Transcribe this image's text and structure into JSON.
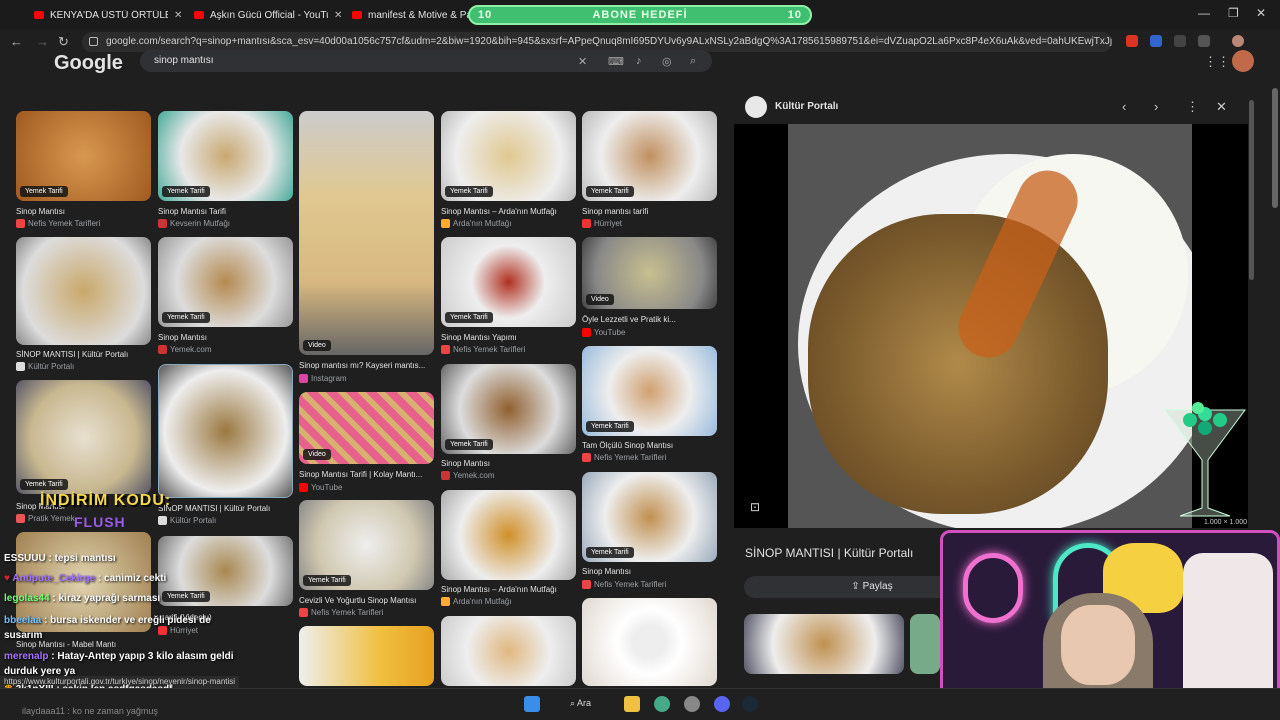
{
  "tabs": [
    {
      "title": "KENYA'DA ÜSTÜ ÖRTÜLEN KO..."
    },
    {
      "title": "Aşkın Gücü Official - YouTube"
    },
    {
      "title": "manifest & Motive & Pango"
    }
  ],
  "goal": {
    "left": "10",
    "label": "ABONE HEDEFİ",
    "right": "10"
  },
  "url": "google.com/search?q=sinop+mantısı&sca_esv=40d00a1056c757cf&udm=2&biw=1920&bih=945&sxsrf=APpeQnuq8mI695DYUv6y9ALxNSLy2aBdgQ%3A1785615989751&ei=dVZuapO2La6Pxc8P4eX6uAk&ved=0ahUKEwjTxJj2oYC...",
  "google": {
    "logo": "Google",
    "query": "sinop mantısı"
  },
  "results": [
    {
      "title": "Sinop Mantısı",
      "source": "Nefis Yemek Tarifleri",
      "pill": "Yemek Tarifi",
      "fav": "#e44"
    },
    {
      "title": "Sinop Mantısı Tarifi",
      "source": "Kevserin Mutfağı",
      "pill": "Yemek Tarifi",
      "fav": "#c33"
    },
    {
      "title": "Sinop mantısı mı? Kayseri mantıs...",
      "source": "Instagram",
      "pill": "Video",
      "fav": "#d4a"
    },
    {
      "title": "Sinop Mantısı – Arda'nın Mutfağı",
      "source": "Arda'nın Mutfağı",
      "pill": "Yemek Tarifi",
      "fav": "#fa3"
    },
    {
      "title": "Sinop mantısı tarifi",
      "source": "Hürriyet",
      "pill": "Yemek Tarifi",
      "fav": "#e33"
    },
    {
      "title": "SİNOP MANTISI | Kültür Portalı",
      "source": "Kültür Portalı",
      "pill": "",
      "fav": "#ddd"
    },
    {
      "title": "Sinop Mantısı",
      "source": "Yemek.com",
      "pill": "Yemek Tarifi",
      "fav": "#c33"
    },
    {
      "title": "Sinop Mantısı Yapımı",
      "source": "Nefis Yemek Tarifleri",
      "pill": "Yemek Tarifi",
      "fav": "#e44"
    },
    {
      "title": "Öyle Lezzetli ve Pratik ki...",
      "source": "YouTube",
      "pill": "Video",
      "fav": "#f00"
    },
    {
      "title": "Sinop Mantısı Tarifi | Kolay Mantı...",
      "source": "YouTube",
      "pill": "Video",
      "fav": "#f00"
    },
    {
      "title": "Sinop Mantısı",
      "source": "Yemek.com",
      "pill": "Yemek Tarifi",
      "fav": "#c33"
    },
    {
      "title": "Tam Ölçülü Sinop Mantısı",
      "source": "Nefis Yemek Tarifleri",
      "pill": "Yemek Tarifi",
      "fav": "#e44"
    },
    {
      "title": "Sinop Mantısı",
      "source": "Pratik Yemek",
      "pill": "Yemek Tarifi",
      "fav": "#e55"
    },
    {
      "title": "SİNOP MANTISI | Kültür Portalı",
      "source": "Kültür Portalı",
      "pill": "",
      "fav": "#ddd"
    },
    {
      "title": "Cevizli Ve Yoğurtlu Sinop Mantısı",
      "source": "Nefis Yemek Tarifleri",
      "pill": "Yemek Tarifi",
      "fav": "#e44"
    },
    {
      "title": "Sinop Mantısı – Arda'nın Mutfağı",
      "source": "Arda'nın Mutfağı",
      "pill": "",
      "fav": "#fa3"
    },
    {
      "title": "Sinop Mantısı",
      "source": "Nefis Yemek Tarifleri",
      "pill": "Yemek Tarifi",
      "fav": "#e44"
    },
    {
      "title": "...arifi (Videolu)",
      "source": "Hürriyet",
      "pill": "Yemek Tarifi",
      "fav": "#e33"
    },
    {
      "title": "Sinop Mantısı - Mabel Mantı",
      "source": "",
      "pill": "",
      "fav": "#fa3"
    }
  ],
  "watermarks": {
    "nefis": "nefis"
  },
  "panel": {
    "site": "Kültür Portalı",
    "title": "SİNOP MANTISI | Kültür Portalı",
    "share": "Paylaş",
    "dims": "1.000 × 1.000"
  },
  "overlay": {
    "indirim": "İNDİRİM KODU:",
    "flush": "FLUSH"
  },
  "chat": [
    {
      "user": "ESSUUU",
      "msg": "tepsi mantısı",
      "color": "#ffffff"
    },
    {
      "user": "Antipute_Cekirge",
      "msg": "canimiz cekti",
      "color": "#a070ff"
    },
    {
      "user": "legolas44",
      "msg": "kiraz yaprağı sarması",
      "color": "#70ff70"
    },
    {
      "user": "bbeelaa",
      "msg": "bursa iskender ve ereğli pidesi de susarım",
      "color": "#70c0ff"
    },
    {
      "user": "merenalp",
      "msg": "Hatay-Antep yapıp 3 kilo alasım geldi durduk yere ya",
      "color": "#a070ff"
    },
    {
      "user": "3k1nXIII",
      "msg": "sakin lan asdfgasdasdf",
      "color": "#ffffff"
    }
  ],
  "status_url": "https://www.kulturportali.gov.tr/turkiye/sinop/neyenir/sinop-mantisi",
  "last_chat": "ilaydaaa11 : ko ne zaman yağmuş",
  "taskbar": {
    "search": "Ara"
  }
}
